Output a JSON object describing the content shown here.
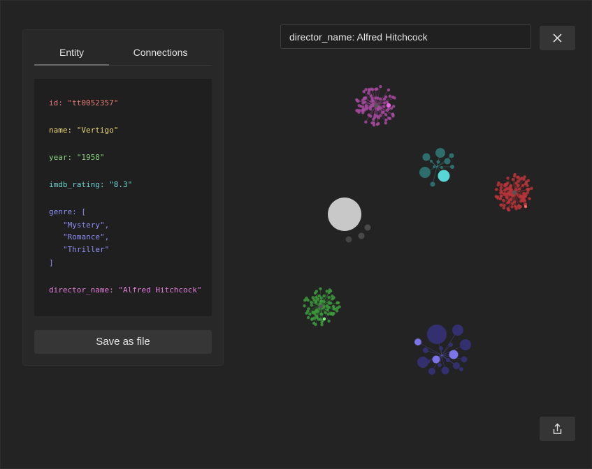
{
  "tabs": {
    "entity": "Entity",
    "connections": "Connections"
  },
  "entity": {
    "id_line": "id: \"tt0052357\"",
    "name_line": "name: \"Vertigo\"",
    "year_line": "year: \"1958\"",
    "rating_line": "imdb_rating: \"8.3\"",
    "genre_open": "genre: [",
    "genre_items": [
      "\"Mystery\",",
      "\"Romance\",",
      "\"Thriller\""
    ],
    "genre_close": "]",
    "director_line": "director_name: \"Alfred Hitchcock\""
  },
  "save_label": "Save as file",
  "search": {
    "value": "director_name: Alfred Hitchcock"
  },
  "icons": {
    "close": "close-icon",
    "share": "share-icon"
  },
  "colors": {
    "background": "#232323",
    "cluster_purple": "#a54a9e",
    "cluster_teal": "#3aa6a0",
    "cluster_red": "#b8353a",
    "cluster_green": "#3d9a3d",
    "cluster_blue": "#5a55c8",
    "center_node": "#c8c8c8"
  }
}
